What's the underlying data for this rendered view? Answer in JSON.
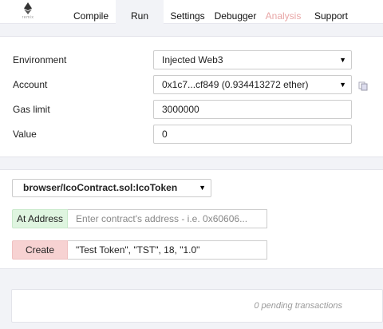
{
  "app": {
    "logo_text": "remix"
  },
  "tabs": [
    {
      "label": "Compile"
    },
    {
      "label": "Run",
      "active": true
    },
    {
      "label": "Settings"
    },
    {
      "label": "Debugger"
    },
    {
      "label": "Analysis",
      "disabled": true
    },
    {
      "label": "Support"
    }
  ],
  "environment": {
    "label": "Environment",
    "value": "Injected Web3"
  },
  "account": {
    "label": "Account",
    "value": "0x1c7...cf849 (0.934413272 ether)"
  },
  "gas_limit": {
    "label": "Gas limit",
    "value": "3000000"
  },
  "value": {
    "label": "Value",
    "value": "0"
  },
  "contract": {
    "selected": "browser/IcoContract.sol:IcoToken"
  },
  "at_address": {
    "button_label": "At Address",
    "placeholder": "Enter contract's address - i.e. 0x60606..."
  },
  "create": {
    "button_label": "Create",
    "args": "\"Test Token\", \"TST\", 18, \"1.0\""
  },
  "pending": {
    "text": "0 pending transactions"
  },
  "colors": {
    "accent_tab_bg": "#f2f3f7",
    "at_address_bg": "#dff5e0",
    "create_bg": "#f7d2d2",
    "disabled_tab": "#e8a5a5"
  }
}
